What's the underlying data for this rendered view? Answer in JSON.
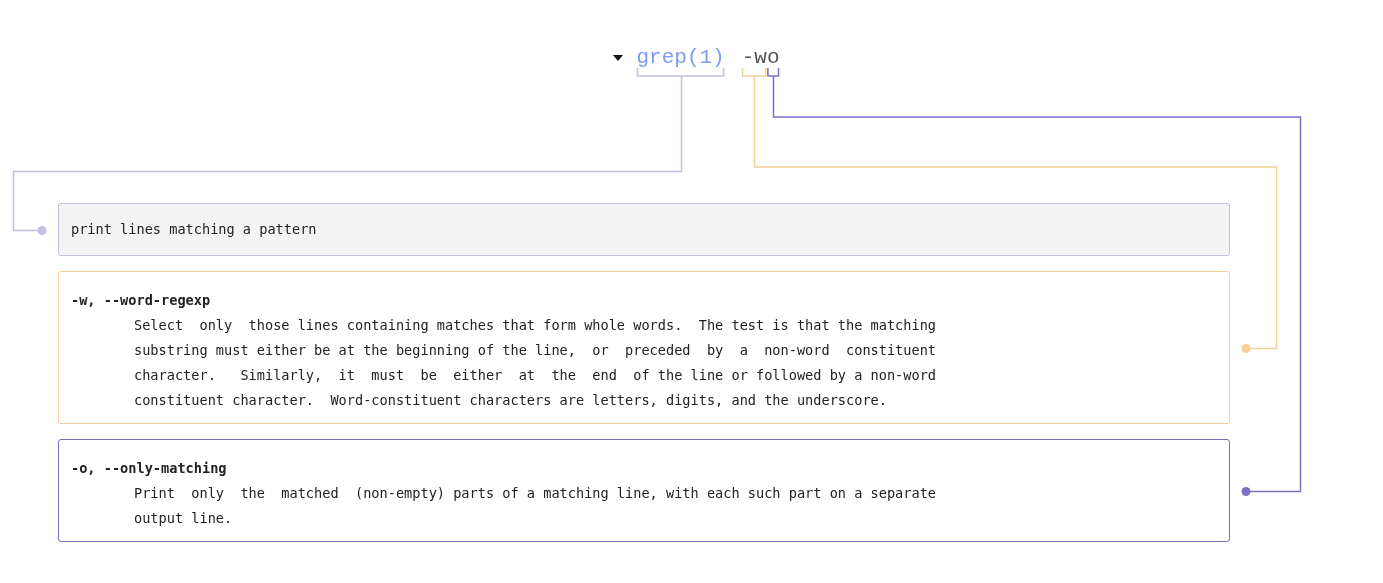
{
  "command": {
    "expanded": true,
    "parts": [
      {
        "text": "grep(1)",
        "kind": "program",
        "color": "#c3c0e2"
      },
      {
        "text": "-w",
        "kind": "option",
        "color": "#f8cf97"
      },
      {
        "text": "o",
        "kind": "option",
        "color": "#7d70c2"
      }
    ]
  },
  "help": [
    {
      "kind": "summary",
      "text": "print lines matching a pattern"
    },
    {
      "kind": "option",
      "heading": "-w, --word-regexp",
      "lines": [
        "Select  only  those lines containing matches that form whole words.  The test is that the matching",
        "substring must either be at the beginning of the line,  or  preceded  by  a  non-word  constituent",
        "character.   Similarly,  it  must  be  either  at  the  end  of the line or followed by a non-word",
        "constituent character.  Word-constituent characters are letters, digits, and the underscore."
      ]
    },
    {
      "kind": "option",
      "heading": "-o, --only-matching",
      "lines": [
        "Print  only  the  matched  (non-empty) parts of a matching line, with each such part on a separate",
        "output line."
      ]
    }
  ]
}
